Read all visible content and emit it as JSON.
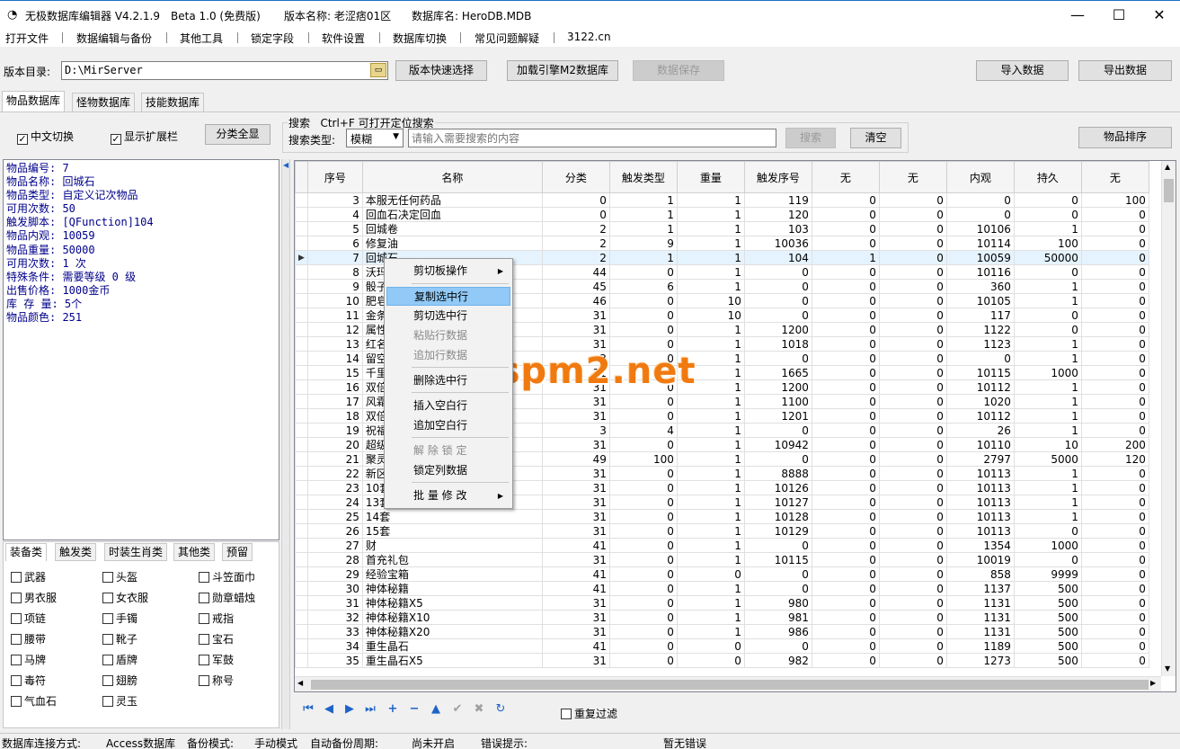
{
  "titlebar": {
    "app_title": "无极数据库编辑器 V4.2.1.9",
    "beta": "Beta 1.0 (免费版)",
    "version_name": "版本名称: 老涩痞01区",
    "db_name": "数据库名: HeroDB.MDB"
  },
  "menu": [
    "打开文件",
    "数据编辑与备份",
    "其他工具",
    "锁定字段",
    "软件设置",
    "数据库切换",
    "常见问题解疑",
    "3122.cn"
  ],
  "toolbar": {
    "dir_label": "版本目录:",
    "dir_value": "D:\\MirServer",
    "quick_select": "版本快速选择",
    "load_engine": "加载引擎M2数据库",
    "save_data": "数据保存",
    "import": "导入数据",
    "export": "导出数据"
  },
  "tabs": [
    "物品数据库",
    "怪物数据库",
    "技能数据库"
  ],
  "options": {
    "chinese_switch": "中文切换",
    "show_ext": "显示扩展栏",
    "show_all": "分类全显"
  },
  "search": {
    "title": "搜索   Ctrl+F 可打开定位搜索",
    "type_label": "搜索类型:",
    "type_value": "模糊",
    "placeholder": "请输入需要搜索的内容",
    "search_btn": "搜索",
    "clear_btn": "清空",
    "sort_btn": "物品排序"
  },
  "item_info": [
    "物品编号: 7",
    "物品名称: 回城石",
    "物品类型: 自定义记次物品",
    "可用次数: 50",
    "触发脚本: [QFunction]104",
    "物品内观: 10059",
    "物品重量: 50000",
    "可用次数: 1 次",
    "特殊条件: 需要等级 0 级",
    "出售价格: 1000金币",
    "库 存 量: 5个",
    "物品颜色: 251"
  ],
  "columns": [
    "序号",
    "名称",
    "分类",
    "触发类型",
    "重量",
    "触发序号",
    "无",
    "无",
    "内观",
    "持久",
    "无"
  ],
  "rows": [
    [
      "3",
      "本服无任何药品",
      "0",
      "1",
      "1",
      "119",
      "0",
      "0",
      "0",
      "0",
      "100"
    ],
    [
      "4",
      "回血石决定回血",
      "0",
      "1",
      "1",
      "120",
      "0",
      "0",
      "0",
      "0",
      "0"
    ],
    [
      "5",
      "回城卷",
      "2",
      "1",
      "1",
      "103",
      "0",
      "0",
      "10106",
      "1",
      "0"
    ],
    [
      "6",
      "修复油",
      "2",
      "9",
      "1",
      "10036",
      "0",
      "0",
      "10114",
      "100",
      "0"
    ],
    [
      "7",
      "回城石",
      "2",
      "1",
      "1",
      "104",
      "1",
      "0",
      "10059",
      "50000",
      "0"
    ],
    [
      "8",
      "沃玛",
      "44",
      "0",
      "1",
      "0",
      "0",
      "0",
      "10116",
      "0",
      "0"
    ],
    [
      "9",
      "骰子",
      "45",
      "6",
      "1",
      "0",
      "0",
      "0",
      "360",
      "1",
      "0"
    ],
    [
      "10",
      "肥皂",
      "46",
      "0",
      "10",
      "0",
      "0",
      "0",
      "10105",
      "1",
      "0"
    ],
    [
      "11",
      "金条",
      "31",
      "0",
      "10",
      "0",
      "0",
      "0",
      "117",
      "0",
      "0"
    ],
    [
      "12",
      "属性",
      "31",
      "0",
      "1",
      "1200",
      "0",
      "0",
      "1122",
      "0",
      "0"
    ],
    [
      "13",
      "红名",
      "31",
      "0",
      "1",
      "1018",
      "0",
      "0",
      "1123",
      "1",
      "0"
    ],
    [
      "14",
      "留空",
      "3",
      "0",
      "1",
      "0",
      "0",
      "0",
      "0",
      "1",
      "0"
    ],
    [
      "15",
      "千里",
      "31",
      "0",
      "1",
      "1665",
      "0",
      "0",
      "10115",
      "1000",
      "0"
    ],
    [
      "16",
      "双倍",
      "31",
      "0",
      "1",
      "1200",
      "0",
      "0",
      "10112",
      "1",
      "0"
    ],
    [
      "17",
      "风霜",
      "31",
      "0",
      "1",
      "1100",
      "0",
      "0",
      "1020",
      "1",
      "0"
    ],
    [
      "18",
      "双倍",
      "31",
      "0",
      "1",
      "1201",
      "0",
      "0",
      "10112",
      "1",
      "0"
    ],
    [
      "19",
      "祝福",
      "3",
      "4",
      "1",
      "0",
      "0",
      "0",
      "26",
      "1",
      "0"
    ],
    [
      "20",
      "超级",
      "31",
      "0",
      "1",
      "10942",
      "0",
      "0",
      "10110",
      "10",
      "200"
    ],
    [
      "21",
      "聚灵",
      "49",
      "100",
      "1",
      "0",
      "0",
      "0",
      "2797",
      "5000",
      "120"
    ],
    [
      "22",
      "新区",
      "31",
      "0",
      "1",
      "8888",
      "0",
      "0",
      "10113",
      "1",
      "0"
    ],
    [
      "23",
      "10套",
      "31",
      "0",
      "1",
      "10126",
      "0",
      "0",
      "10113",
      "1",
      "0"
    ],
    [
      "24",
      "13套",
      "31",
      "0",
      "1",
      "10127",
      "0",
      "0",
      "10113",
      "1",
      "0"
    ],
    [
      "25",
      "14套",
      "31",
      "0",
      "1",
      "10128",
      "0",
      "0",
      "10113",
      "1",
      "0"
    ],
    [
      "26",
      "15套",
      "31",
      "0",
      "1",
      "10129",
      "0",
      "0",
      "10113",
      "0",
      "0"
    ],
    [
      "27",
      "财",
      "41",
      "0",
      "1",
      "0",
      "0",
      "0",
      "1354",
      "1000",
      "0"
    ],
    [
      "28",
      "首充礼包",
      "31",
      "0",
      "1",
      "10115",
      "0",
      "0",
      "10019",
      "0",
      "0"
    ],
    [
      "29",
      "经验宝箱",
      "41",
      "0",
      "0",
      "0",
      "0",
      "0",
      "858",
      "9999",
      "0"
    ],
    [
      "30",
      "神体秘籍",
      "41",
      "0",
      "1",
      "0",
      "0",
      "0",
      "1137",
      "500",
      "0"
    ],
    [
      "31",
      "神体秘籍X5",
      "31",
      "0",
      "1",
      "980",
      "0",
      "0",
      "1131",
      "500",
      "0"
    ],
    [
      "32",
      "神体秘籍X10",
      "31",
      "0",
      "1",
      "981",
      "0",
      "0",
      "1131",
      "500",
      "0"
    ],
    [
      "33",
      "神体秘籍X20",
      "31",
      "0",
      "1",
      "986",
      "0",
      "0",
      "1131",
      "500",
      "0"
    ],
    [
      "34",
      "重生晶石",
      "41",
      "0",
      "0",
      "0",
      "0",
      "0",
      "1189",
      "500",
      "0"
    ],
    [
      "35",
      "重生晶石X5",
      "31",
      "0",
      "0",
      "982",
      "0",
      "0",
      "1273",
      "500",
      "0"
    ]
  ],
  "context_menu": {
    "clipboard": "剪切板操作",
    "copy_row": "复制选中行",
    "cut_row": "剪切选中行",
    "paste_row": "粘贴行数据",
    "append_row": "追加行数据",
    "delete_row": "删除选中行",
    "insert_blank": "插入空白行",
    "append_blank": "追加空白行",
    "unlock": "解 除 锁 定",
    "lock_col": "锁定列数据",
    "batch_edit": "批 量 修 改"
  },
  "watermark": "lspm2.net",
  "dedupe": "重复过滤",
  "category_tabs": [
    "装备类",
    "触发类",
    "时装生肖类",
    "其他类",
    "预留"
  ],
  "categories": [
    "武器",
    "头盔",
    "斗笠面巾",
    "男衣服",
    "女衣服",
    "勋章蜡烛",
    "项链",
    "手镯",
    "戒指",
    "腰带",
    "靴子",
    "宝石",
    "马牌",
    "盾牌",
    "军鼓",
    "毒符",
    "翅膀",
    "称号",
    "气血石",
    "灵玉"
  ],
  "status": {
    "conn_label": "数据库连接方式:",
    "conn_value": "Access数据库",
    "backup_label": "备份模式:",
    "backup_value": "手动模式",
    "auto_label": "自动备份周期:",
    "auto_value": "尚未开启",
    "error_label": "错误提示:",
    "error_value": "暂无错误"
  }
}
